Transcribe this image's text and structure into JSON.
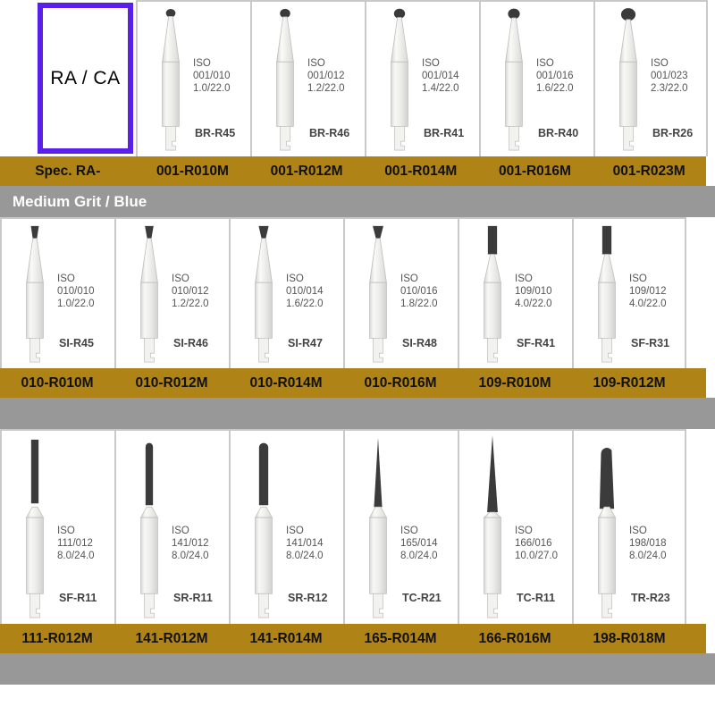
{
  "legend": {
    "box_label": "RA / CA",
    "box_border_color": "#5b20e8"
  },
  "colors": {
    "gold_band": "#b08317",
    "gray_band": "#989898",
    "bur_head": "#3b3b3b",
    "cell_border": "#c9c9c9",
    "info_text": "#555555"
  },
  "bands": {
    "section_grit": "Medium Grit / Blue",
    "spec_prefix": "Spec. RA-"
  },
  "rows": [
    {
      "id": "row-1",
      "head_shape": "round-ball",
      "burs": [
        {
          "iso_label": "ISO",
          "iso_number": "001/010",
          "iso_size": "1.0/22.0",
          "code": "BR-R45",
          "order_number": "001-R010M",
          "head_size": 1.0
        },
        {
          "iso_label": "ISO",
          "iso_number": "001/012",
          "iso_size": "1.2/22.0",
          "code": "BR-R46",
          "order_number": "001-R012M",
          "head_size": 1.2
        },
        {
          "iso_label": "ISO",
          "iso_number": "001/014",
          "iso_size": "1.4/22.0",
          "code": "BR-R41",
          "order_number": "001-R014M",
          "head_size": 1.4
        },
        {
          "iso_label": "ISO",
          "iso_number": "001/016",
          "iso_size": "1.6/22.0",
          "code": "BR-R40",
          "order_number": "001-R016M",
          "head_size": 1.6
        },
        {
          "iso_label": "ISO",
          "iso_number": "001/023",
          "iso_size": "2.3/22.0",
          "code": "BR-R26",
          "order_number": "001-R023M",
          "head_size": 2.3
        }
      ]
    },
    {
      "id": "row-2",
      "head_shape": "inverted-cone",
      "burs": [
        {
          "iso_label": "ISO",
          "iso_number": "010/010",
          "iso_size": "1.0/22.0",
          "code": "SI-R45",
          "order_number": "010-R010M",
          "head_size": 1.0
        },
        {
          "iso_label": "ISO",
          "iso_number": "010/012",
          "iso_size": "1.2/22.0",
          "code": "SI-R46",
          "order_number": "010-R012M",
          "head_size": 1.2
        },
        {
          "iso_label": "ISO",
          "iso_number": "010/014",
          "iso_size": "1.6/22.0",
          "code": "SI-R47",
          "order_number": "010-R014M",
          "head_size": 1.6
        },
        {
          "iso_label": "ISO",
          "iso_number": "010/016",
          "iso_size": "1.8/22.0",
          "code": "SI-R48",
          "order_number": "010-R016M",
          "head_size": 1.8
        },
        {
          "iso_label": "ISO",
          "iso_number": "109/010",
          "iso_size": "4.0/22.0",
          "code": "SF-R41",
          "order_number": "109-R010M",
          "head_size": 4.0
        },
        {
          "iso_label": "ISO",
          "iso_number": "109/012",
          "iso_size": "4.0/22.0",
          "code": "SF-R31",
          "order_number": "109-R012M",
          "head_size": 4.0
        }
      ]
    },
    {
      "id": "row-3",
      "head_shape": "long-taper",
      "burs": [
        {
          "iso_label": "ISO",
          "iso_number": "111/012",
          "iso_size": "8.0/24.0",
          "code": "SF-R11",
          "order_number": "111-R012M",
          "head_size": 8.0
        },
        {
          "iso_label": "ISO",
          "iso_number": "141/012",
          "iso_size": "8.0/24.0",
          "code": "SR-R11",
          "order_number": "141-R012M",
          "head_size": 8.0
        },
        {
          "iso_label": "ISO",
          "iso_number": "141/014",
          "iso_size": "8.0/24.0",
          "code": "SR-R12",
          "order_number": "141-R014M",
          "head_size": 8.0
        },
        {
          "iso_label": "ISO",
          "iso_number": "165/014",
          "iso_size": "8.0/24.0",
          "code": "TC-R21",
          "order_number": "165-R014M",
          "head_size": 8.0
        },
        {
          "iso_label": "ISO",
          "iso_number": "166/016",
          "iso_size": "10.0/27.0",
          "code": "TC-R11",
          "order_number": "166-R016M",
          "head_size": 10.0
        },
        {
          "iso_label": "ISO",
          "iso_number": "198/018",
          "iso_size": "8.0/24.0",
          "code": "TR-R23",
          "order_number": "198-R018M",
          "head_size": 8.0
        }
      ]
    }
  ]
}
